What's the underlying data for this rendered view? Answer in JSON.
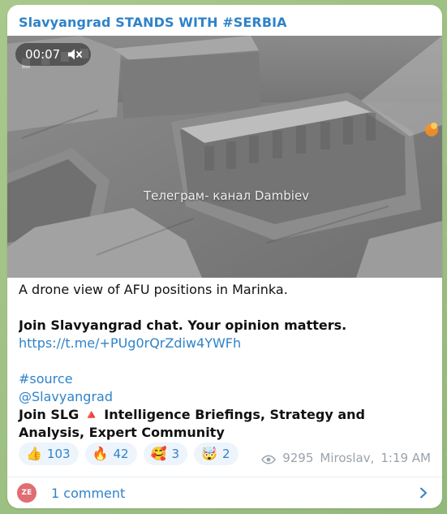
{
  "channel": {
    "title": "Slavyangrad STANDS WITH #SERBIA"
  },
  "media": {
    "timer": "00:07",
    "mute_icon": "muted-speaker-icon",
    "watermark": "Телеграм- канал Dambiev"
  },
  "post": {
    "line1": "A drone view of AFU positions in Marinka.",
    "line2": "Join Slavyangrad chat. Your opinion matters.",
    "link1": "https://t.me/+PUg0rQrZdiw4YWFh",
    "hashtag": "#source",
    "handle": "@Slavyangrad",
    "line3": "Join SLG 🔺 Intelligence Briefings, Strategy and Analysis, Expert Community"
  },
  "reactions": [
    {
      "emoji": "👍",
      "count": "103"
    },
    {
      "emoji": "🔥",
      "count": "42"
    },
    {
      "emoji": "🥰",
      "count": "3"
    },
    {
      "emoji": "🤯",
      "count": "2"
    }
  ],
  "meta": {
    "views": "9295",
    "author": "Miroslav,",
    "time": "1:19 AM"
  },
  "comments": {
    "avatar_text": "ZE",
    "label": "1 comment"
  },
  "colors": {
    "accent": "#2f83c9",
    "muted": "#9aa3ab",
    "card_bg": "#ffffff",
    "chat_bg": "#9fc186",
    "avatar_bg": "#e06d72"
  },
  "icons": {
    "views": "eye-icon",
    "comments_next": "chevron-right-icon"
  }
}
